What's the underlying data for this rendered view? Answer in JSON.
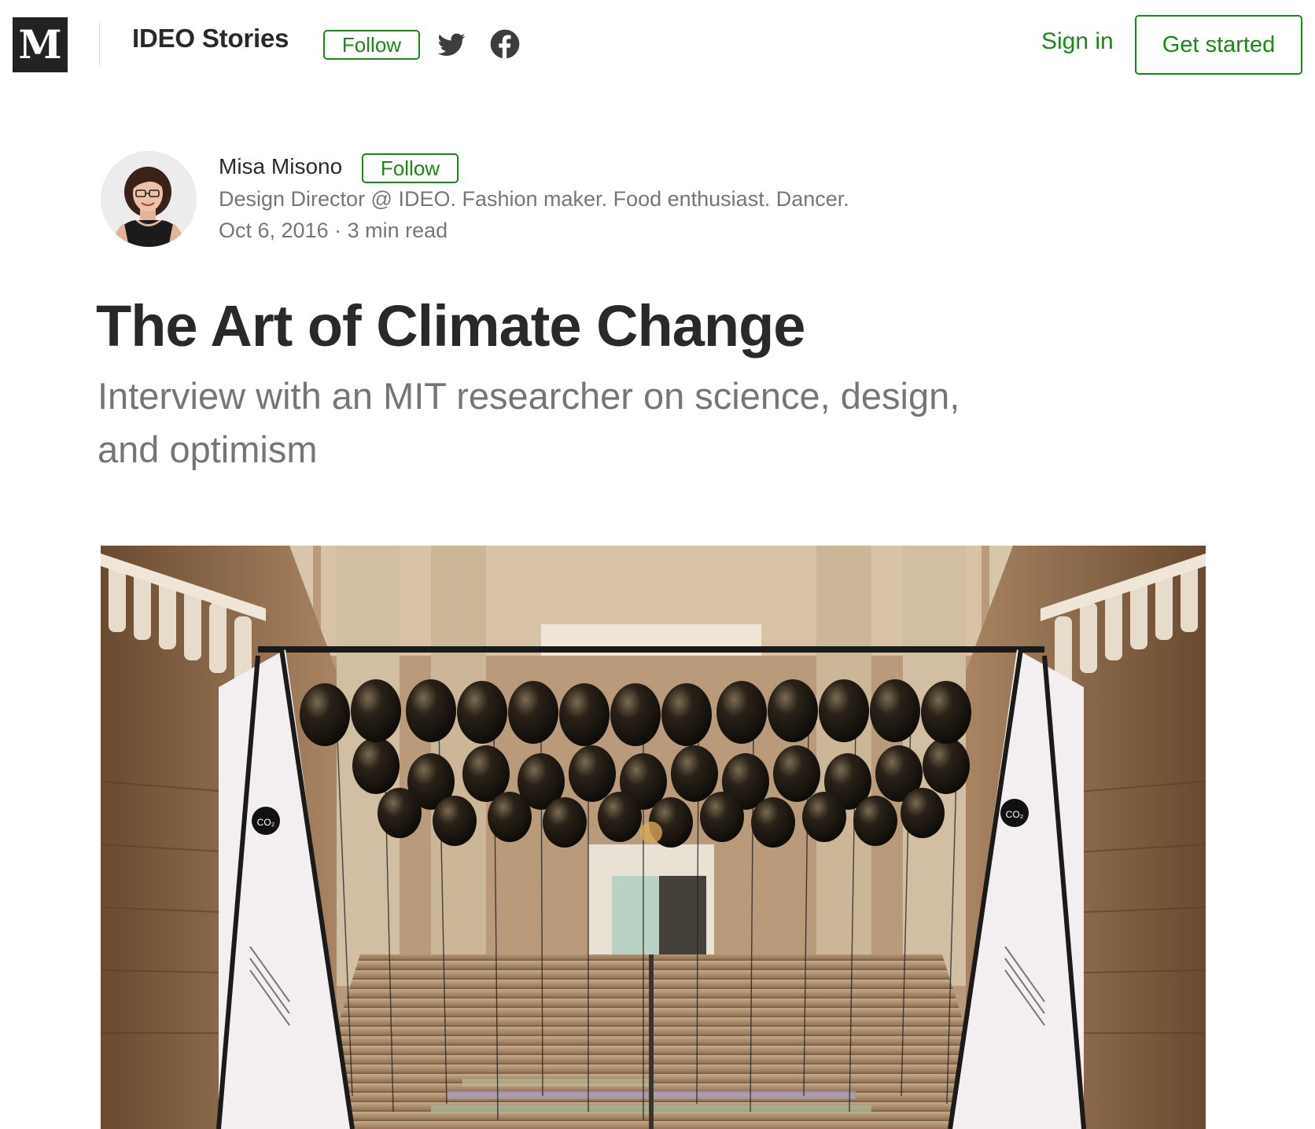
{
  "header": {
    "logo_letter": "M",
    "publication_name": "IDEO Stories",
    "follow_label": "Follow",
    "twitter_icon": "twitter-icon",
    "facebook_icon": "facebook-icon",
    "signin_label": "Sign in",
    "get_started_label": "Get started"
  },
  "author": {
    "name": "Misa Misono",
    "follow_label": "Follow",
    "bio": "Design Director @ IDEO. Fashion maker. Food enthusiast. Dancer.",
    "date": "Oct 6, 2016",
    "separator": "·",
    "read_time": "3 min read"
  },
  "article": {
    "title": "The Art of Climate Change",
    "subtitle": "Interview with an MIT researcher on science, design, and optimism"
  },
  "hero_image": {
    "label_co2": "CO₂"
  },
  "colors": {
    "accent_green": "#1a8917",
    "logo_bg": "#222222",
    "text_dark": "rgba(0,0,0,0.84)",
    "text_muted": "rgba(0,0,0,0.54)"
  }
}
